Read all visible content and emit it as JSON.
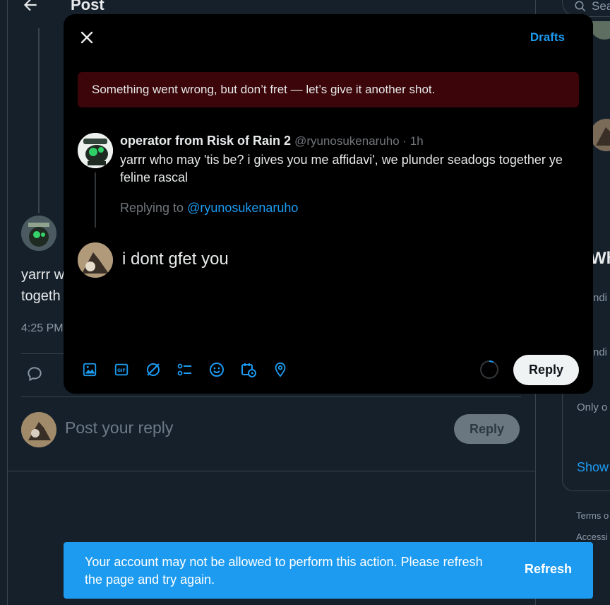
{
  "background": {
    "page_title": "Post",
    "post_text": "yarrr w\ntogeth",
    "post_time": "4:25 PM",
    "reply_placeholder": "Post your reply",
    "reply_button": "Reply"
  },
  "sidebar": {
    "search_text": "Sea",
    "card_title": "Wha",
    "trend_1": "ndi",
    "trend_2": "ndi",
    "trend_3": "Only o",
    "show_more": "Show",
    "footer_1": "Terms o",
    "footer_2": "Accessi"
  },
  "modal": {
    "drafts_label": "Drafts",
    "error_message": "Something went wrong, but don’t fret — let’s give it another shot.",
    "original_post": {
      "author_name": "operator from Risk of Rain 2",
      "meta": "@ryunosukenaruho · 1h",
      "text": "yarrr who may 'tis be? i gives you me affidavi', we plunder seadogs together ye feline rascal",
      "replying_prefix": "Replying to ",
      "replying_handle": "@ryunosukenaruho"
    },
    "compose_text": "i dont gfet you",
    "reply_button": "Reply",
    "toolbar_icons": [
      "media-icon",
      "gif-icon",
      "grok-icon",
      "poll-icon",
      "emoji-icon",
      "schedule-icon",
      "location-icon"
    ]
  },
  "toast": {
    "message": "Your account may not be allowed to perform this action. Please refresh the page and try again.",
    "action": "Refresh"
  },
  "colors": {
    "accent": "#1d9bf0",
    "background": "#15202b",
    "modal": "#000000",
    "error_banner": "#3b0509"
  }
}
